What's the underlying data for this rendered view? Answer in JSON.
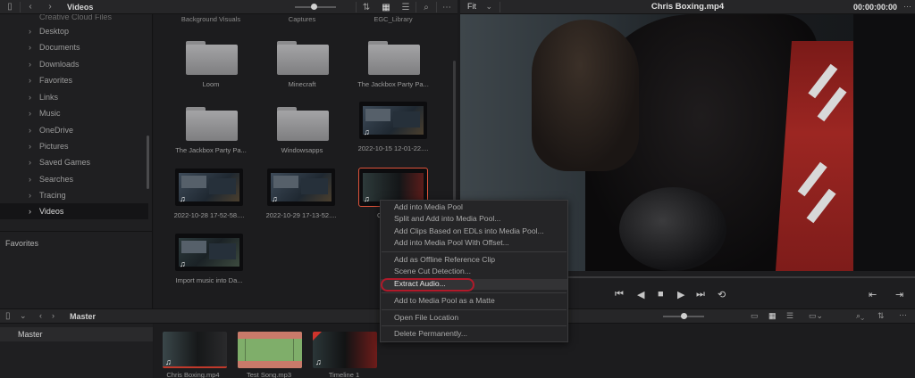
{
  "browser_header": {
    "title": "Videos"
  },
  "viewer_header": {
    "fit_label": "Fit",
    "clip_title": "Chris Boxing.mp4",
    "timecode": "00:00:00:00"
  },
  "sidebar": {
    "items": [
      {
        "label": "Creative Cloud Files",
        "state": "cut"
      },
      {
        "label": "Desktop"
      },
      {
        "label": "Documents"
      },
      {
        "label": "Downloads"
      },
      {
        "label": "Favorites"
      },
      {
        "label": "Links"
      },
      {
        "label": "Music"
      },
      {
        "label": "OneDrive"
      },
      {
        "label": "Pictures"
      },
      {
        "label": "Saved Games"
      },
      {
        "label": "Searches"
      },
      {
        "label": "Tracing"
      },
      {
        "label": "Videos",
        "state": "selected"
      }
    ],
    "favorites_label": "Favorites"
  },
  "browser": {
    "top_row": [
      "Background Visuals",
      "Captures",
      "EGC_Library"
    ],
    "folders": [
      {
        "name": "Loom"
      },
      {
        "name": "Minecraft"
      },
      {
        "name": "The Jackbox Party Pa..."
      },
      {
        "name": "The Jackbox Party Pa..."
      },
      {
        "name": "Windowsapps"
      }
    ],
    "videos": [
      {
        "name": "2022-10-15 12-01-22...."
      },
      {
        "name": "2022-10-28 17-52-58...."
      },
      {
        "name": "2022-10-29 17-13-52...."
      },
      {
        "name": "Chr"
      },
      {
        "name": "Import music into Da..."
      }
    ]
  },
  "context_menu": {
    "items": [
      "Add into Media Pool",
      "Split and Add into Media Pool...",
      "Add Clips Based on EDLs into Media Pool...",
      "Add into Media Pool With Offset...",
      "Add as Offline Reference Clip",
      "Scene Cut Detection...",
      "Extract Audio...",
      "Add to Media Pool as a Matte",
      "Open File Location",
      "Delete Permanently..."
    ],
    "highlighted": "Extract Audio..."
  },
  "bottom_bar": {
    "title": "Master"
  },
  "bin_list": {
    "items": [
      "Master"
    ]
  },
  "media_pool": {
    "clips": [
      {
        "name": "Chris Boxing.mp4"
      },
      {
        "name": "Test Song.mp3"
      },
      {
        "name": "Timeline 1"
      }
    ]
  },
  "colors": {
    "accent_red": "#b01a2a",
    "selection_outline": "#e0533a",
    "panel_bg": "#1c1c1e"
  }
}
